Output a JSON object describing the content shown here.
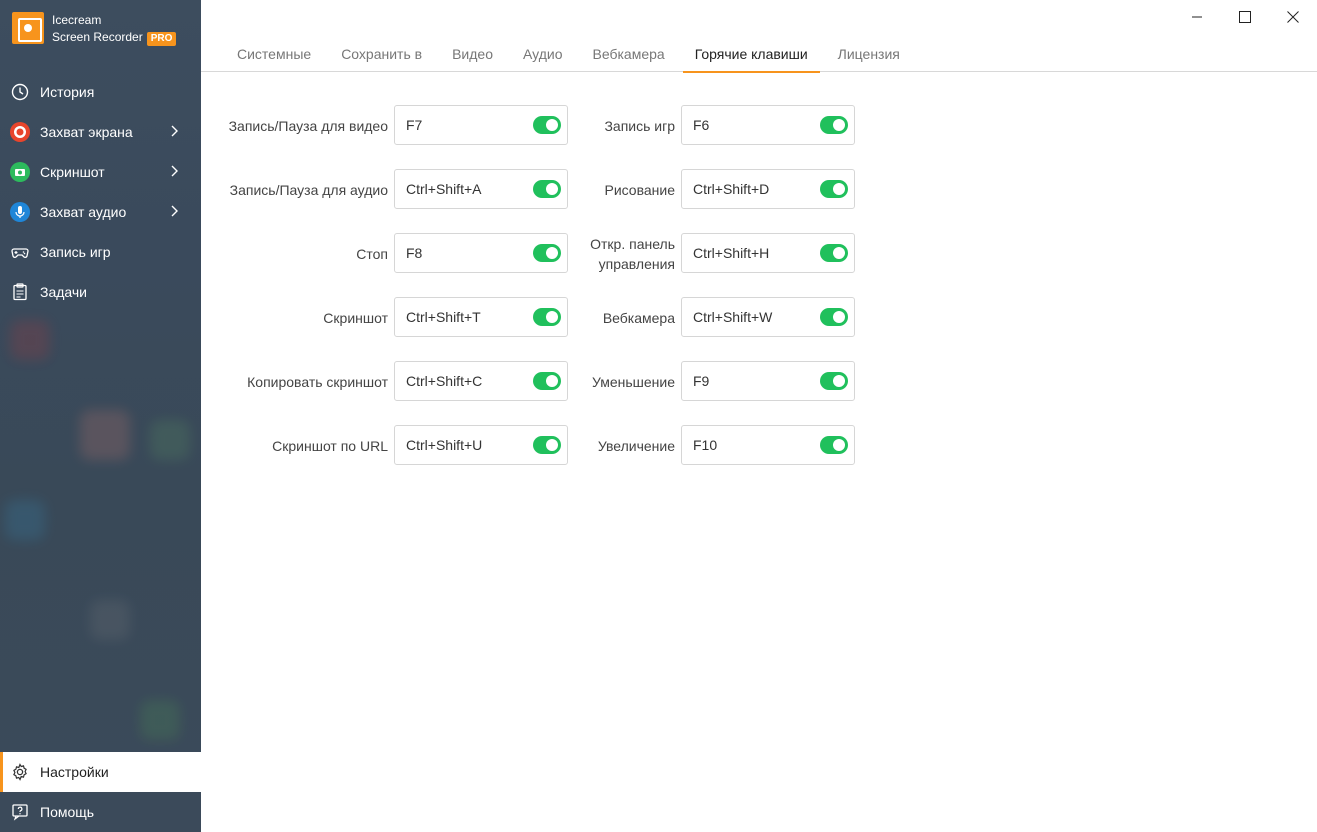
{
  "app": {
    "name_line1": "Icecream",
    "name_line2": "Screen Recorder",
    "badge": "PRO",
    "accent_color": "#f7941d",
    "toggle_color": "#20c05c"
  },
  "sidebar": {
    "items": [
      {
        "label": "История",
        "icon": "clock-icon"
      },
      {
        "label": "Захват экрана",
        "icon": "record-icon",
        "has_submenu": true
      },
      {
        "label": "Скриншот",
        "icon": "camera-icon",
        "has_submenu": true
      },
      {
        "label": "Захват аудио",
        "icon": "microphone-icon",
        "has_submenu": true
      },
      {
        "label": "Запись игр",
        "icon": "gamepad-icon"
      },
      {
        "label": "Задачи",
        "icon": "tasks-icon"
      }
    ],
    "bottom_items": [
      {
        "label": "Настройки",
        "icon": "gear-icon",
        "active": true
      },
      {
        "label": "Помощь",
        "icon": "help-icon"
      }
    ]
  },
  "tabs": [
    {
      "label": "Системные"
    },
    {
      "label": "Сохранить в"
    },
    {
      "label": "Видео"
    },
    {
      "label": "Аудио"
    },
    {
      "label": "Вебкамера"
    },
    {
      "label": "Горячие клавиши",
      "active": true
    },
    {
      "label": "Лицензия"
    }
  ],
  "hotkeys_left": [
    {
      "label": "Запись/Пауза для видео",
      "value": "F7",
      "enabled": true
    },
    {
      "label": "Запись/Пауза для аудио",
      "value": "Ctrl+Shift+A",
      "enabled": true
    },
    {
      "label": "Стоп",
      "value": "F8",
      "enabled": true
    },
    {
      "label": "Скриншот",
      "value": "Ctrl+Shift+T",
      "enabled": true
    },
    {
      "label": "Копировать скриншот",
      "value": "Ctrl+Shift+C",
      "enabled": true
    },
    {
      "label": "Скриншот по URL",
      "value": "Ctrl+Shift+U",
      "enabled": true
    }
  ],
  "hotkeys_right": [
    {
      "label": "Запись игр",
      "value": "F6",
      "enabled": true
    },
    {
      "label": "Рисование",
      "value": "Ctrl+Shift+D",
      "enabled": true
    },
    {
      "label_line1": "Откр. панель",
      "label_line2": "управления",
      "value": "Ctrl+Shift+H",
      "enabled": true
    },
    {
      "label": "Вебкамера",
      "value": "Ctrl+Shift+W",
      "enabled": true
    },
    {
      "label": "Уменьшение",
      "value": "F9",
      "enabled": true
    },
    {
      "label": "Увеличение",
      "value": "F10",
      "enabled": true
    }
  ]
}
